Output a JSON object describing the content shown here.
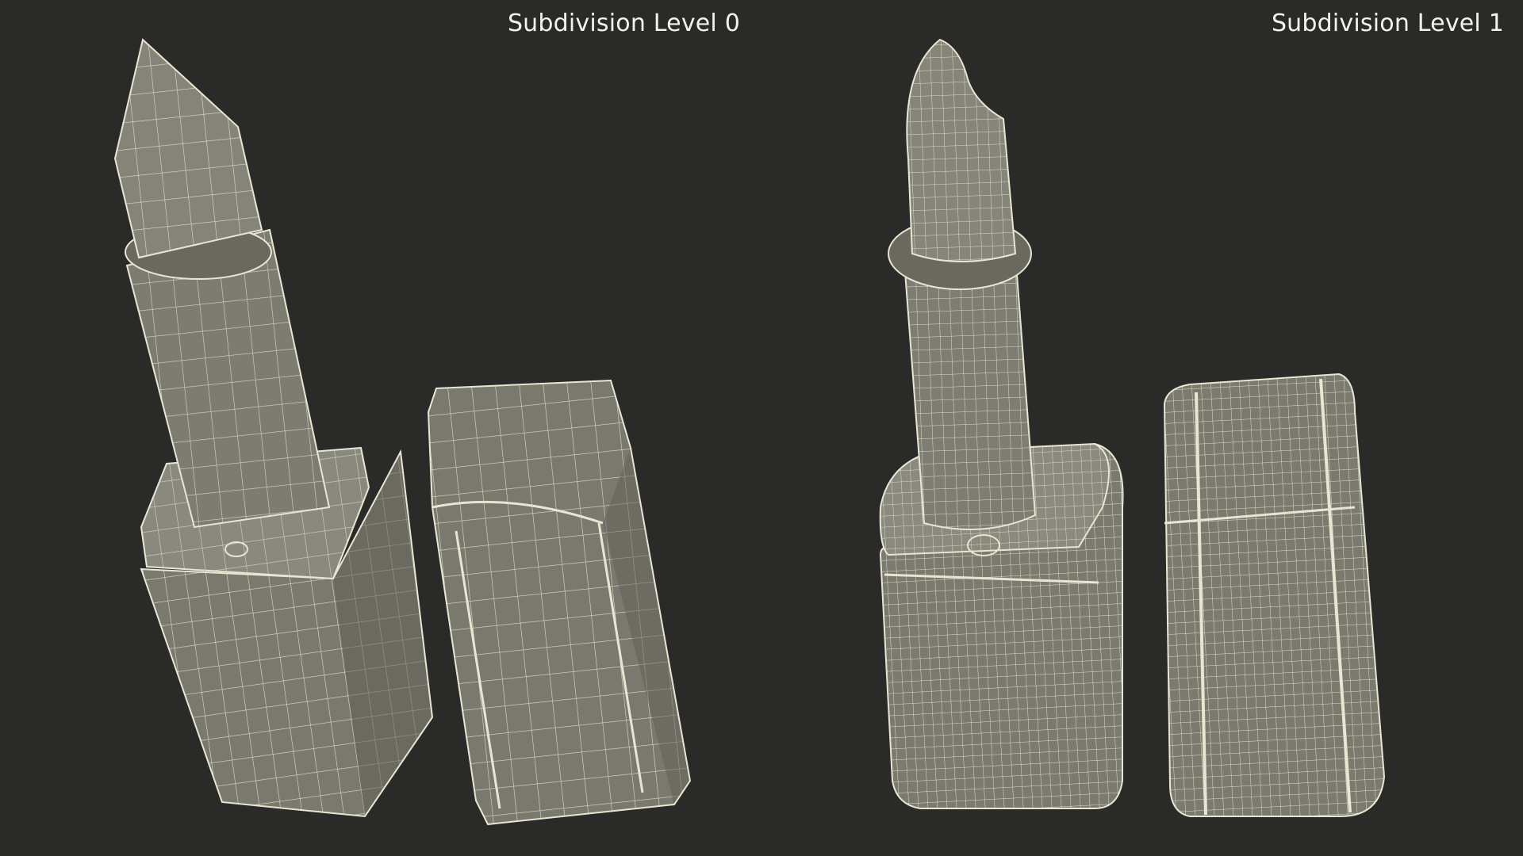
{
  "panels": [
    {
      "label": "Subdivision Level 0"
    },
    {
      "label": "Subdivision Level 1"
    }
  ],
  "colors": {
    "background": "#2a2a28",
    "mesh_fill": "#7c7b70",
    "mesh_shade": "#5f5e55",
    "wire": "#e8e6d2",
    "label": "#f2f2ef"
  }
}
